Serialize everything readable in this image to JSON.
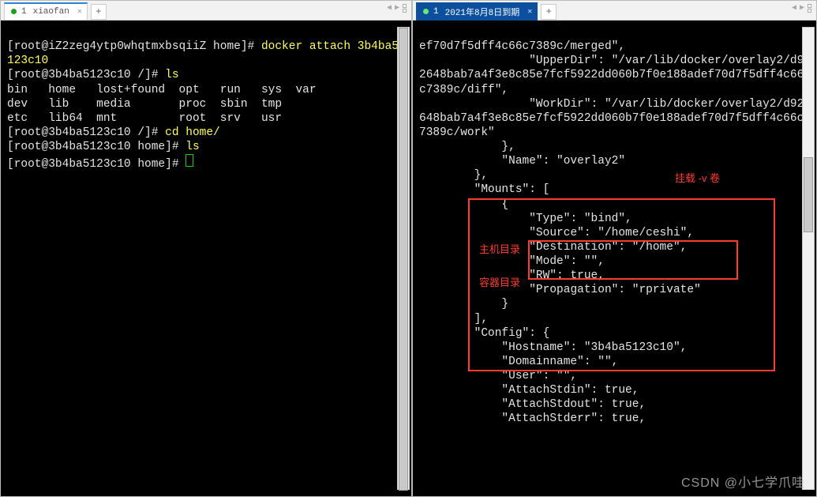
{
  "leftPane": {
    "tab": {
      "num": "1",
      "title": "xiaofan"
    },
    "prompt1": "[root@iZ2zeg4ytp0whqtmxbsqiiZ home]# ",
    "cmd1": "docker attach 3b4ba5123c10",
    "prompt2": "[root@3b4ba5123c10 /]# ",
    "cmd2": "ls",
    "ls1": "bin   home   lost+found  opt   run   sys  var",
    "ls2": "dev   lib    media       proc  sbin  tmp",
    "ls3": "etc   lib64  mnt         root  srv   usr",
    "prompt3": "[root@3b4ba5123c10 /]# ",
    "cmd3": "cd home/",
    "prompt4": "[root@3b4ba5123c10 home]# ",
    "cmd4": "ls",
    "prompt5": "[root@3b4ba5123c10 home]# "
  },
  "rightPane": {
    "tab": {
      "num": "1",
      "title": "2021年8月8日到期"
    },
    "annotations": {
      "mountNote": "挂载 -v 卷",
      "hostDir": "主机目录",
      "containerDir": "容器目录"
    },
    "json": {
      "mergedTail": "ef70d7f5dff4c66c7389c/merged\",",
      "upperDirKey": "\"UpperDir\": ",
      "upperDirVal": "\"/var/lib/docker/overlay2/d92648bab7a4f3e8c85e7fcf5922dd060b7f0e188adef70d7f5dff4c66c7389c/diff\",",
      "workDirKey": "\"WorkDir\": ",
      "workDirVal": "\"/var/lib/docker/overlay2/d92648bab7a4f3e8c85e7fcf5922dd060b7f0e188adef70d7f5dff4c66c7389c/work\"",
      "closeBrace1": "            },",
      "nameLine": "            \"Name\": \"overlay2\"",
      "closeBrace2": "        },",
      "mountsOpen": "        \"Mounts\": [",
      "mountsObjOpen": "            {",
      "typeLine": "                \"Type\": \"bind\",",
      "sourceLine": "                \"Source\": \"/home/ceshi\",",
      "destLine": "                \"Destination\": \"/home\",",
      "modeLine": "                \"Mode\": \"\",",
      "rwLine": "                \"RW\": true,",
      "propLine": "                \"Propagation\": \"rprivate\"",
      "mountsObjClose": "            }",
      "mountsClose": "        ],",
      "configOpen": "        \"Config\": {",
      "hostnameLine": "            \"Hostname\": \"3b4ba5123c10\",",
      "domainLine": "            \"Domainname\": \"\",",
      "userLine": "            \"User\": \"\",",
      "attachStdin": "            \"AttachStdin\": true,",
      "attachStdout": "            \"AttachStdout\": true,",
      "attachStderr": "            \"AttachStderr\": true,"
    }
  },
  "watermark": "CSDN @小七学爪哇"
}
